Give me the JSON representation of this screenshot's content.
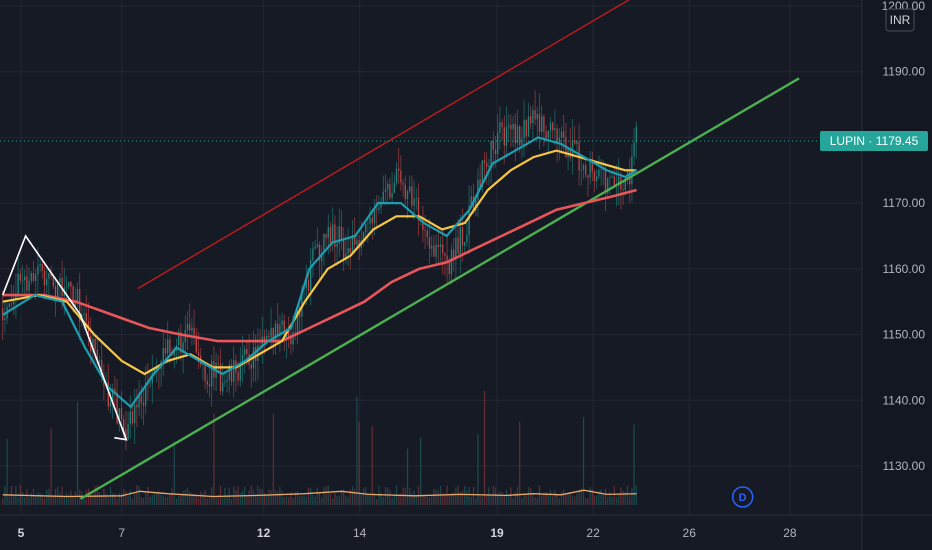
{
  "chart_data": {
    "type": "candlestick",
    "currency": "INR",
    "symbol": "LUPIN",
    "last_price": 1179.45,
    "last_label": "LUPIN · 1179.45",
    "interval_badge": "D",
    "ylim": [
      1123,
      1201
    ],
    "y_ticks": [
      1130,
      1140,
      1150,
      1160,
      1170,
      1180,
      1190,
      1200
    ],
    "x_ticks": [
      {
        "label": "5",
        "x": 0.0,
        "bold": true
      },
      {
        "label": "7",
        "x": 2.2,
        "bold": false
      },
      {
        "label": "12",
        "x": 5.3,
        "bold": true
      },
      {
        "label": "14",
        "x": 7.4,
        "bold": false
      },
      {
        "label": "19",
        "x": 10.4,
        "bold": true
      },
      {
        "label": "22",
        "x": 12.5,
        "bold": false
      },
      {
        "label": "26",
        "x": 14.6,
        "bold": false
      },
      {
        "label": "28",
        "x": 16.8,
        "bold": false
      }
    ],
    "xlim": [
      -0.4,
      18.5
    ],
    "grid": true,
    "colors": {
      "background": "#161a25",
      "up": "#26a69a",
      "down": "#ef5350",
      "ma_fast": "#1e9cb0",
      "ma_mid": "#f7c744",
      "ma_slow": "#e9565a",
      "channel_upper": "#b71c1c",
      "channel_lower": "#4caf50",
      "pattern": "#ffffff",
      "volume_ma": "#e6a96b",
      "badge_bg": "#26a69a",
      "badge_d": "#2962ff"
    },
    "price_path": [
      [
        -0.4,
        1154
      ],
      [
        0.0,
        1158
      ],
      [
        0.4,
        1160
      ],
      [
        0.8,
        1157
      ],
      [
        1.2,
        1156
      ],
      [
        1.5,
        1149
      ],
      [
        1.9,
        1141
      ],
      [
        2.3,
        1136
      ],
      [
        2.6,
        1140
      ],
      [
        3.0,
        1145
      ],
      [
        3.4,
        1149
      ],
      [
        3.7,
        1150
      ],
      [
        4.1,
        1144
      ],
      [
        4.5,
        1143
      ],
      [
        4.9,
        1146
      ],
      [
        5.3,
        1148
      ],
      [
        5.6,
        1150
      ],
      [
        6.0,
        1151
      ],
      [
        6.4,
        1162
      ],
      [
        6.8,
        1166
      ],
      [
        7.1,
        1163
      ],
      [
        7.5,
        1166
      ],
      [
        7.9,
        1172
      ],
      [
        8.3,
        1174
      ],
      [
        8.6,
        1170
      ],
      [
        9.0,
        1164
      ],
      [
        9.4,
        1161
      ],
      [
        9.8,
        1168
      ],
      [
        10.1,
        1176
      ],
      [
        10.5,
        1181
      ],
      [
        10.9,
        1180
      ],
      [
        11.3,
        1183
      ],
      [
        11.6,
        1181
      ],
      [
        12.0,
        1178
      ],
      [
        12.4,
        1176
      ],
      [
        12.8,
        1173
      ],
      [
        13.1,
        1172
      ],
      [
        13.3,
        1175
      ],
      [
        13.45,
        1180
      ]
    ],
    "ma_fast": [
      [
        -0.4,
        1153
      ],
      [
        0.3,
        1156
      ],
      [
        0.9,
        1155
      ],
      [
        1.4,
        1148
      ],
      [
        1.9,
        1142
      ],
      [
        2.4,
        1139
      ],
      [
        2.9,
        1144
      ],
      [
        3.4,
        1148
      ],
      [
        3.9,
        1146
      ],
      [
        4.4,
        1144
      ],
      [
        4.9,
        1146
      ],
      [
        5.4,
        1149
      ],
      [
        5.9,
        1151
      ],
      [
        6.3,
        1160
      ],
      [
        6.8,
        1164
      ],
      [
        7.3,
        1165
      ],
      [
        7.8,
        1170
      ],
      [
        8.3,
        1170
      ],
      [
        8.8,
        1167
      ],
      [
        9.3,
        1165
      ],
      [
        9.8,
        1169
      ],
      [
        10.3,
        1176
      ],
      [
        10.8,
        1178
      ],
      [
        11.3,
        1180
      ],
      [
        11.8,
        1179
      ],
      [
        12.3,
        1177
      ],
      [
        12.8,
        1175
      ],
      [
        13.2,
        1174
      ],
      [
        13.45,
        1175
      ]
    ],
    "ma_mid": [
      [
        -0.4,
        1155
      ],
      [
        0.4,
        1156
      ],
      [
        1.0,
        1155
      ],
      [
        1.6,
        1150
      ],
      [
        2.2,
        1146
      ],
      [
        2.7,
        1144
      ],
      [
        3.2,
        1146
      ],
      [
        3.7,
        1147
      ],
      [
        4.2,
        1145
      ],
      [
        4.7,
        1145
      ],
      [
        5.2,
        1147
      ],
      [
        5.7,
        1149
      ],
      [
        6.2,
        1155
      ],
      [
        6.7,
        1160
      ],
      [
        7.2,
        1162
      ],
      [
        7.7,
        1166
      ],
      [
        8.2,
        1168
      ],
      [
        8.7,
        1168
      ],
      [
        9.2,
        1166
      ],
      [
        9.7,
        1167
      ],
      [
        10.2,
        1172
      ],
      [
        10.7,
        1175
      ],
      [
        11.2,
        1177
      ],
      [
        11.7,
        1178
      ],
      [
        12.2,
        1177
      ],
      [
        12.7,
        1176
      ],
      [
        13.2,
        1175
      ],
      [
        13.45,
        1175
      ]
    ],
    "ma_slow": [
      [
        -0.4,
        1156
      ],
      [
        0.5,
        1156
      ],
      [
        1.2,
        1155
      ],
      [
        2.0,
        1153
      ],
      [
        2.8,
        1151
      ],
      [
        3.5,
        1150
      ],
      [
        4.3,
        1149
      ],
      [
        5.0,
        1149
      ],
      [
        5.7,
        1149
      ],
      [
        6.3,
        1151
      ],
      [
        6.9,
        1153
      ],
      [
        7.5,
        1155
      ],
      [
        8.1,
        1158
      ],
      [
        8.7,
        1160
      ],
      [
        9.3,
        1161
      ],
      [
        9.9,
        1163
      ],
      [
        10.5,
        1165
      ],
      [
        11.1,
        1167
      ],
      [
        11.7,
        1169
      ],
      [
        12.3,
        1170
      ],
      [
        12.9,
        1171
      ],
      [
        13.45,
        1172
      ]
    ],
    "channel_upper": [
      [
        2.55,
        1157
      ],
      [
        13.3,
        1201
      ]
    ],
    "channel_lower": [
      [
        1.3,
        1125
      ],
      [
        17.0,
        1189
      ]
    ],
    "pattern_path": [
      [
        -0.4,
        1156
      ],
      [
        0.1,
        1165
      ],
      [
        1.3,
        1153
      ],
      [
        2.3,
        1134
      ]
    ],
    "volume_ma": [
      [
        -0.4,
        0.35
      ],
      [
        1.0,
        0.3
      ],
      [
        2.2,
        0.32
      ],
      [
        2.6,
        0.45
      ],
      [
        3.2,
        0.38
      ],
      [
        4.2,
        0.3
      ],
      [
        5.2,
        0.33
      ],
      [
        6.2,
        0.38
      ],
      [
        7.0,
        0.45
      ],
      [
        7.6,
        0.36
      ],
      [
        8.6,
        0.32
      ],
      [
        9.6,
        0.36
      ],
      [
        10.6,
        0.33
      ],
      [
        11.2,
        0.38
      ],
      [
        11.8,
        0.35
      ],
      [
        12.3,
        0.48
      ],
      [
        12.8,
        0.36
      ],
      [
        13.45,
        0.38
      ]
    ]
  }
}
